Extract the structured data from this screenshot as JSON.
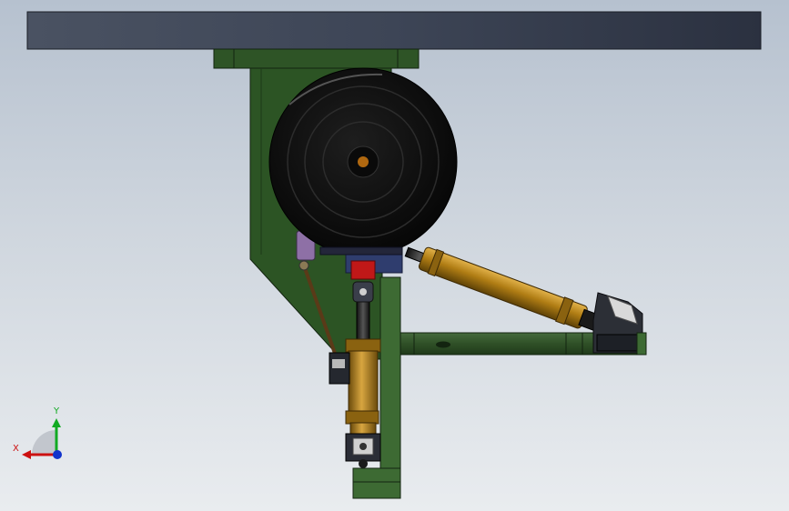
{
  "viewport": {
    "background_top": "#b6c1cf",
    "background_bottom": "#e9ecef"
  },
  "triad": {
    "x_label": "X",
    "y_label": "Y",
    "x_color": "#cc1111",
    "y_color": "#11aa22",
    "z_color": "#1133cc"
  },
  "model": {
    "beam_color": "#3a4150",
    "frame_color": "#2f5a25",
    "wheel_color": "#121212",
    "cylinder_color": "#b7861a",
    "accent_color": "#c01818"
  }
}
